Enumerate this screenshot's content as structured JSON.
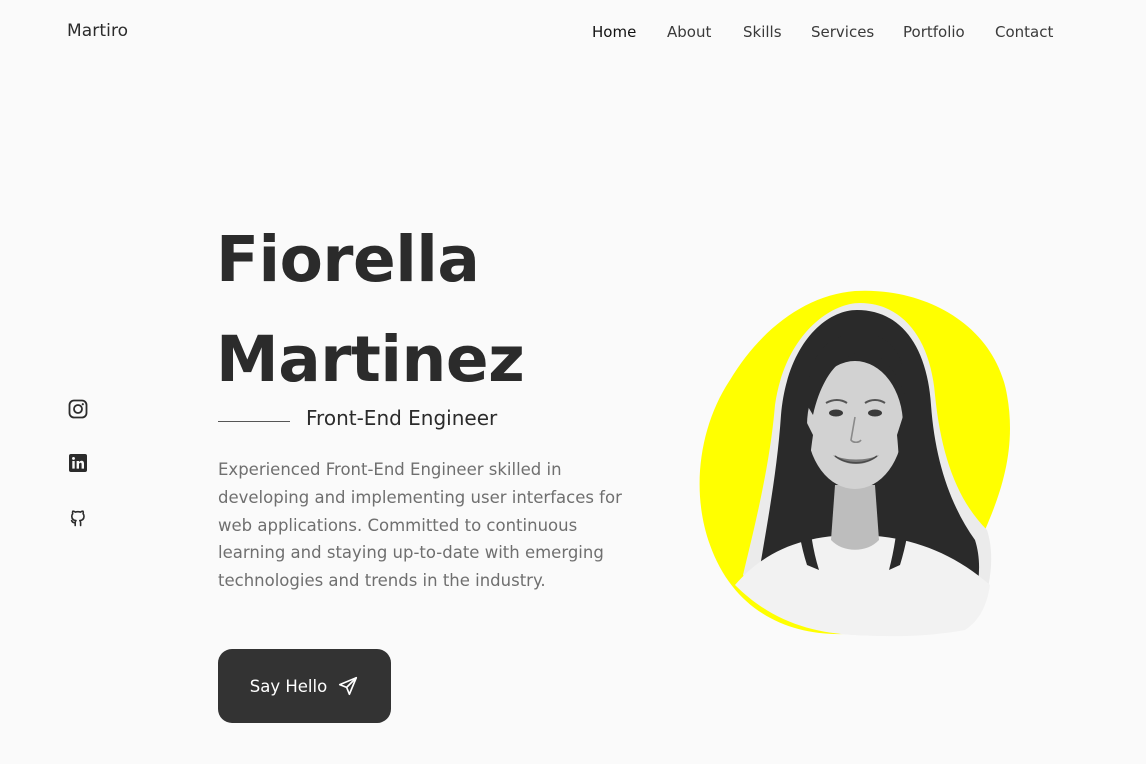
{
  "header": {
    "logo": "Martiro",
    "nav": [
      {
        "label": "Home",
        "active": true
      },
      {
        "label": "About",
        "active": false
      },
      {
        "label": "Skills",
        "active": false
      },
      {
        "label": "Services",
        "active": false
      },
      {
        "label": "Portfolio",
        "active": false
      },
      {
        "label": "Contact",
        "active": false
      }
    ]
  },
  "social": [
    "instagram-icon",
    "linkedin-icon",
    "github-icon"
  ],
  "hero": {
    "first_name": "Fiorella",
    "last_name": "Martinez",
    "subtitle": "Front-End Engineer",
    "description": "Experienced Front-End Engineer skilled in developing and implementing user interfaces for web applications. Committed to continuous learning and staying up-to-date with emerging technologies and trends in the industry.",
    "cta_label": "Say Hello"
  },
  "colors": {
    "accent": "#ffff00",
    "text": "#2b2b2b",
    "button": "#333333",
    "background": "#fafafa"
  }
}
